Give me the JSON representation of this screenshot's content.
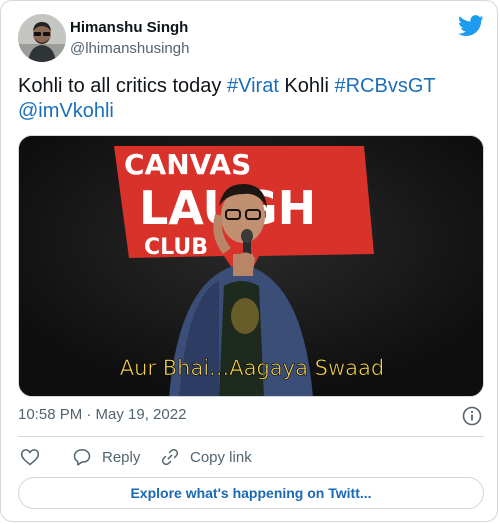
{
  "author": {
    "name": "Himanshu Singh",
    "handle": "@lhimanshusingh"
  },
  "tweet": {
    "segments": [
      {
        "text": "Kohli to all critics today ",
        "type": "text"
      },
      {
        "text": "#Virat",
        "type": "link"
      },
      {
        "text": " Kohli ",
        "type": "text"
      },
      {
        "text": "#RCBvsGT",
        "type": "link"
      },
      {
        "text": " ",
        "type": "text"
      },
      {
        "text": "@imVkohli",
        "type": "link"
      }
    ]
  },
  "media": {
    "sign_line1": "CANVAS",
    "sign_line2": "LAUGH",
    "sign_line3": "CLUB",
    "caption": "Aur Bhai...Aagaya Swaad"
  },
  "meta": {
    "timestamp": "10:58 PM · May 19, 2022"
  },
  "actions": {
    "reply_label": "Reply",
    "copy_label": "Copy link"
  },
  "explore_label": "Explore what's happening on Twitt...",
  "colors": {
    "link": "#1b6fb8",
    "twitter_blue": "#1d9bf0",
    "muted": "#536471",
    "border": "#cfd9de"
  }
}
